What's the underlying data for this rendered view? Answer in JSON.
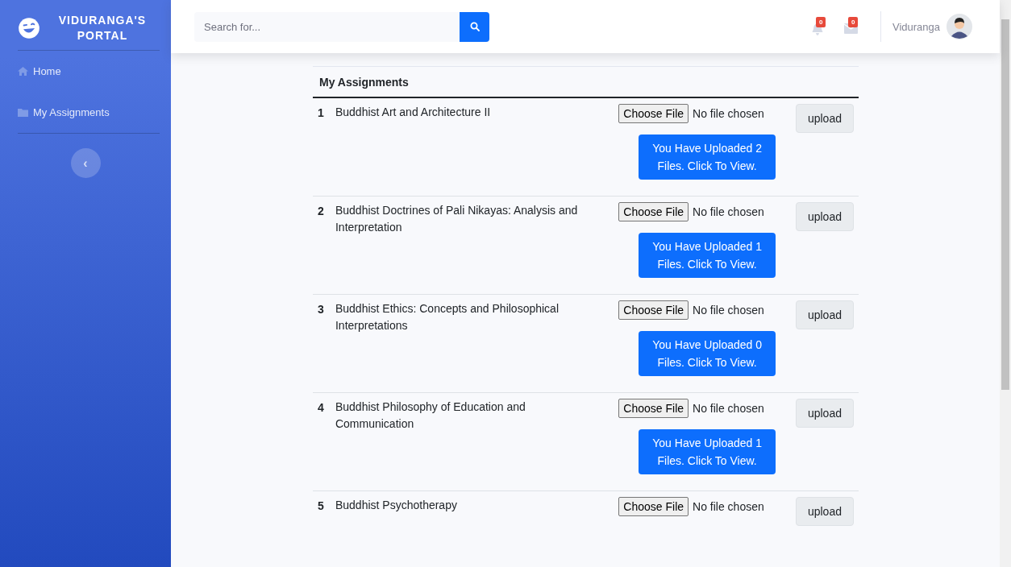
{
  "sidebar": {
    "brand": "VIDURANGA'S PORTAL",
    "items": [
      {
        "label": "Home",
        "kind": "home"
      },
      {
        "label": "My Assignments",
        "kind": "folder"
      }
    ],
    "toggle": "‹"
  },
  "topbar": {
    "search": {
      "placeholder": "Search for..."
    },
    "alerts": [
      {
        "kind": "bell",
        "count": "0"
      },
      {
        "kind": "envelope",
        "count": "0"
      }
    ],
    "user": "Viduranga"
  },
  "table": {
    "title": "My Assignments",
    "rows": [
      {
        "number": "1",
        "name": "Buddhist Art and Architecture II",
        "choose": "Choose File",
        "file_status": "No file chosen",
        "upload": "upload",
        "view": "You Have Uploaded 2 Files. Click To View."
      },
      {
        "number": "2",
        "name": "Buddhist Doctrines of Pali Nikayas: Analysis and Interpretation",
        "choose": "Choose File",
        "file_status": "No file chosen",
        "upload": "upload",
        "view": "You Have Uploaded 1 Files. Click To View."
      },
      {
        "number": "3",
        "name": "Buddhist Ethics: Concepts and Philosophical Interpretations",
        "choose": "Choose File",
        "file_status": "No file chosen",
        "upload": "upload",
        "view": "You Have Uploaded 0 Files. Click To View."
      },
      {
        "number": "4",
        "name": "Buddhist Philosophy of Education and Communication",
        "choose": "Choose File",
        "file_status": "No file chosen",
        "upload": "upload",
        "view": "You Have Uploaded 1 Files. Click To View."
      },
      {
        "number": "5",
        "name": "Buddhist Psychotherapy",
        "choose": "Choose File",
        "file_status": "No file chosen",
        "upload": "upload"
      }
    ]
  }
}
